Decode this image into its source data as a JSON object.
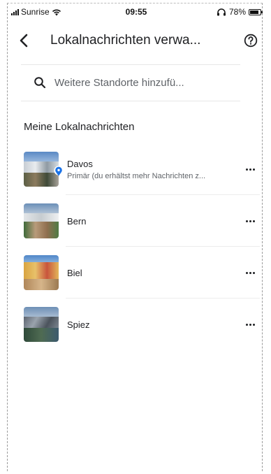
{
  "status_bar": {
    "carrier": "Sunrise",
    "time": "09:55",
    "battery": "78%",
    "battery_level": 0.78
  },
  "header": {
    "title": "Lokalnachrichten verwa..."
  },
  "search": {
    "placeholder": "Weitere Standorte hinzufü..."
  },
  "section": {
    "title": "Meine Lokalnachrichten"
  },
  "locations": [
    {
      "name": "Davos",
      "subtitle": "Primär (du erhältst mehr Nachrichten z...",
      "primary": true
    },
    {
      "name": "Bern",
      "subtitle": "",
      "primary": false
    },
    {
      "name": "Biel",
      "subtitle": "",
      "primary": false
    },
    {
      "name": "Spiez",
      "subtitle": "",
      "primary": false
    }
  ],
  "icons": {
    "back": "back-arrow-icon",
    "help": "help-circle-icon",
    "search": "search-icon",
    "more": "more-horiz-icon",
    "primary_pin": "location-pin-icon"
  },
  "colors": {
    "pin": "#1a73e8",
    "text_primary": "#202124",
    "text_secondary": "#5f6368"
  }
}
